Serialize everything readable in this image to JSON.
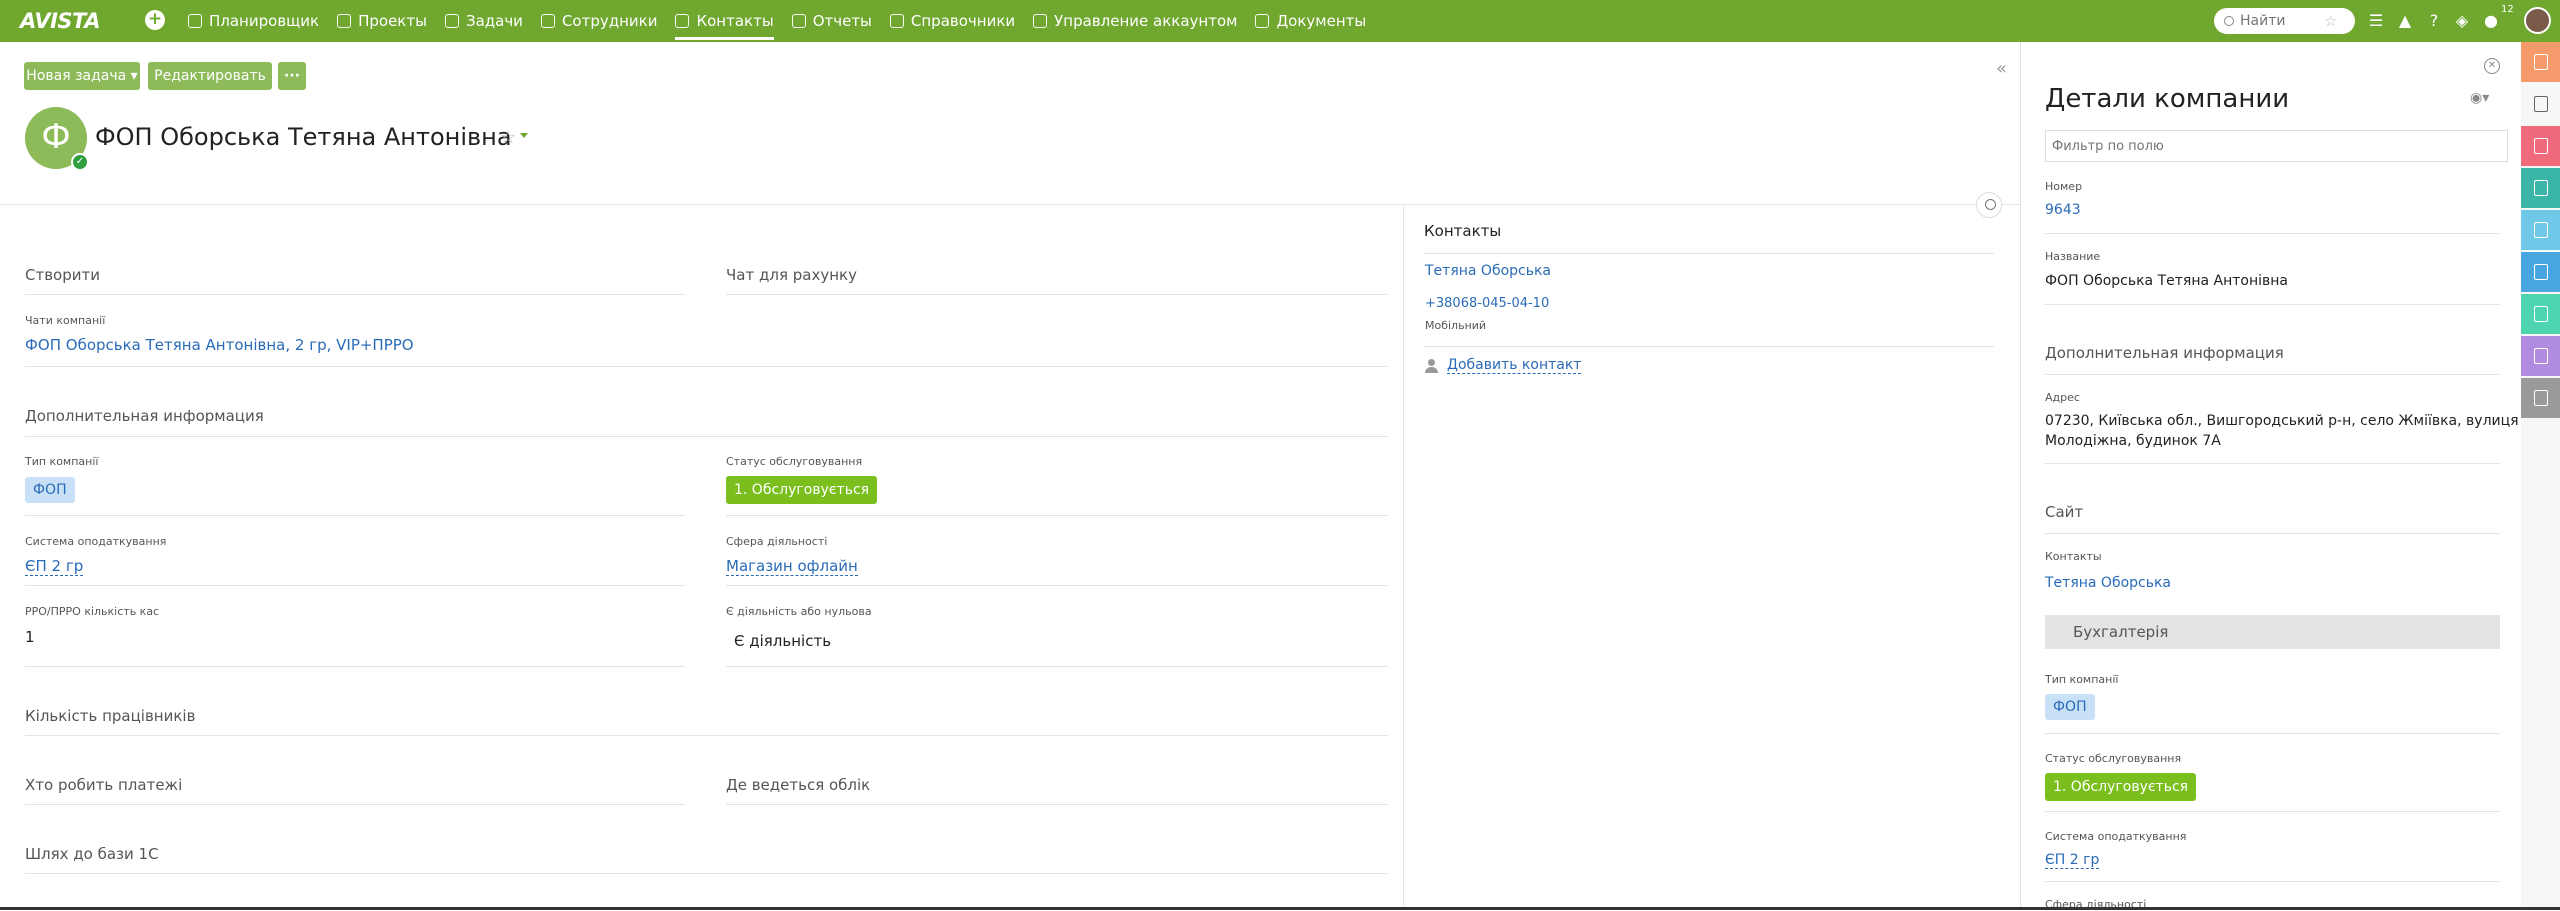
{
  "topbar": {
    "logo": "AVISTA",
    "nav": [
      {
        "label": "Планировщик",
        "icon": "planner-icon"
      },
      {
        "label": "Проекты",
        "icon": "projects-icon"
      },
      {
        "label": "Задачи",
        "icon": "tasks-icon"
      },
      {
        "label": "Сотрудники",
        "icon": "employees-icon"
      },
      {
        "label": "Контакты",
        "icon": "contacts-icon",
        "active": true
      },
      {
        "label": "Отчеты",
        "icon": "reports-icon"
      },
      {
        "label": "Справочники",
        "icon": "references-icon"
      },
      {
        "label": "Управление аккаунтом",
        "icon": "account-icon"
      },
      {
        "label": "Документы",
        "icon": "documents-icon"
      }
    ],
    "search_placeholder": "Найти",
    "notifications_count": "12",
    "brand_color": "#6fa72f"
  },
  "toolbar": {
    "new_task": "Новая задача ▾",
    "edit": "Редактировать",
    "more": "···"
  },
  "company": {
    "initial": "Ф",
    "title": "ФОП Оборська Тетяна Антонівна"
  },
  "main": {
    "create": "Створити",
    "chat_for_invoice": "Чат для рахунку",
    "company_chats_label": "Чати компанії",
    "company_chats_value": "ФОП Оборська Тетяна Антонівна, 2 гр, VIP+ПРРО",
    "additional_info": "Дополнительная информация",
    "company_type_label": "Тип компанії",
    "company_type_value": "ФОП",
    "service_status_label": "Статус обслуговування",
    "service_status_value": "1. Обслуговується",
    "tax_system_label": "Система оподаткування",
    "tax_system_value": "ЄП 2 гр",
    "activity_sphere_label": "Сфера діяльності",
    "activity_sphere_value": "Магазин офлайн",
    "rro_label": "РРО/ПРРО кількість кас",
    "rro_value": "1",
    "activity_or_zero_label": "Є діяльність або нульова",
    "activity_or_zero_value": "Є діяльність",
    "employees_count": "Кількість працівників",
    "who_pays": "Хто робить платежі",
    "where_accounting": "Де ведеться облік",
    "path_1c": "Шлях до бази 1С"
  },
  "contacts": {
    "title": "Контакты",
    "name": "Тетяна Оборська",
    "phone": "+38068-045-04-10",
    "phone_type": "Мобільний",
    "add_contact": "Добавить контакт"
  },
  "details": {
    "title": "Детали компании",
    "filter_placeholder": "Фильтр по полю",
    "number_label": "Номер",
    "number_value": "9643",
    "name_label": "Название",
    "name_value": "ФОП Оборська Тетяна Антонівна",
    "additional_info": "Дополнительная информация",
    "address_label": "Адрес",
    "address_line1": "07230, Київська обл., Вишгородський р-н, село Жміївка, вулиця",
    "address_line2": "Молодіжна, будинок 7А",
    "site": "Сайт",
    "contacts_label": "Контакты",
    "contacts_value": "Тетяна Оборська",
    "accounting_group": "Бухгалтерія",
    "company_type_label": "Тип компанії",
    "company_type_value": "ФОП",
    "service_status_label": "Статус обслуговування",
    "service_status_value": "1. Обслуговується",
    "tax_system_label": "Система оподаткування",
    "tax_system_value": "ЄП 2 гр",
    "activity_sphere_label": "Сфера діяльності"
  },
  "strip_colors": [
    "#f59a6b",
    "#f7f7f7",
    "#ef6b7b",
    "#3bb5a8",
    "#6fc8e8",
    "#4aa6e0",
    "#4fd4b0",
    "#b08be0",
    "#9a9a9a"
  ]
}
